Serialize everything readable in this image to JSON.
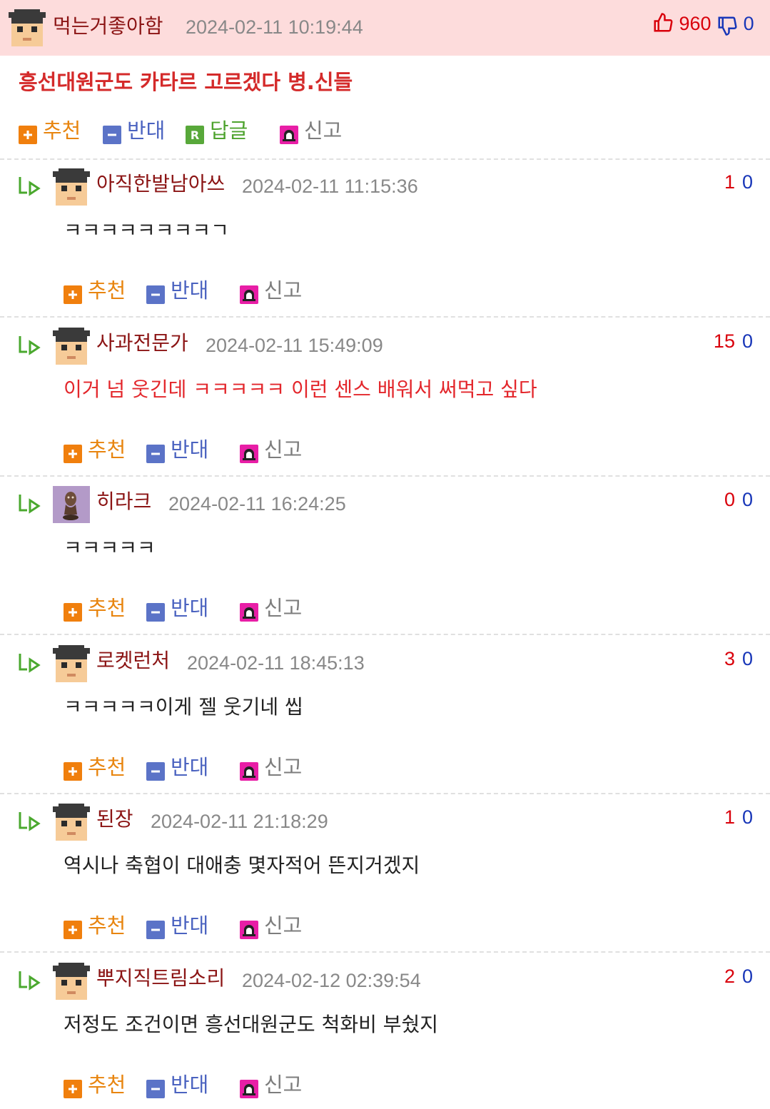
{
  "post": {
    "author": "먹는거좋아함",
    "date": "2024-02-11 10:19:44",
    "upvotes": "960",
    "downvotes": "0",
    "title": "흥선대원군도 카타르 고르겠다 병.신들",
    "actions": {
      "recommend": "추천",
      "oppose": "반대",
      "reply": "답글",
      "report": "신고"
    }
  },
  "comment_actions": {
    "recommend": "추천",
    "oppose": "반대",
    "report": "신고"
  },
  "comments": [
    {
      "author": "아직한발남아쓰",
      "date": "2024-02-11 11:15:36",
      "up": "1",
      "down": "0",
      "text": "ㅋㅋㅋㅋㅋㅋㅋㅋㄱ",
      "avatar": "grad-cap"
    },
    {
      "author": "사과전문가",
      "date": "2024-02-11 15:49:09",
      "up": "15",
      "down": "0",
      "text": "이거 넘 웃긴데 ㅋㅋㅋㅋㅋ 이런 센스 배워서 써먹고 싶다",
      "avatar": "grad-cap",
      "highlight": true
    },
    {
      "author": "히라크",
      "date": "2024-02-11 16:24:25",
      "up": "0",
      "down": "0",
      "text": "ㅋㅋㅋㅋㅋ",
      "avatar": "custom-figure"
    },
    {
      "author": "로켓런처",
      "date": "2024-02-11 18:45:13",
      "up": "3",
      "down": "0",
      "text": "ㅋㅋㅋㅋㅋ이게 젤 웃기네 씹",
      "avatar": "grad-cap"
    },
    {
      "author": "된장",
      "date": "2024-02-11 21:18:29",
      "up": "1",
      "down": "0",
      "text": "역시나 축협이 대애충 몇자적어 뜬지거겠지",
      "avatar": "grad-cap"
    },
    {
      "author": "뿌지직트림소리",
      "date": "2024-02-12 02:39:54",
      "up": "2",
      "down": "0",
      "text": "저정도 조건이면 흥선대원군도 척화비 부쉈지",
      "avatar": "grad-cap"
    }
  ],
  "colors": {
    "header_bg": "#fddcdc",
    "author_name": "#8b1414",
    "title_red": "#d42a2a",
    "highlight_text": "#e3262b",
    "up_count": "#d9000b",
    "down_count": "#1836b8",
    "recommend": "#e8850f",
    "oppose": "#4b63c0",
    "reply": "#4ea32e",
    "report_icon": "#e81ea6",
    "reply_arrow": "#4aa82e"
  }
}
